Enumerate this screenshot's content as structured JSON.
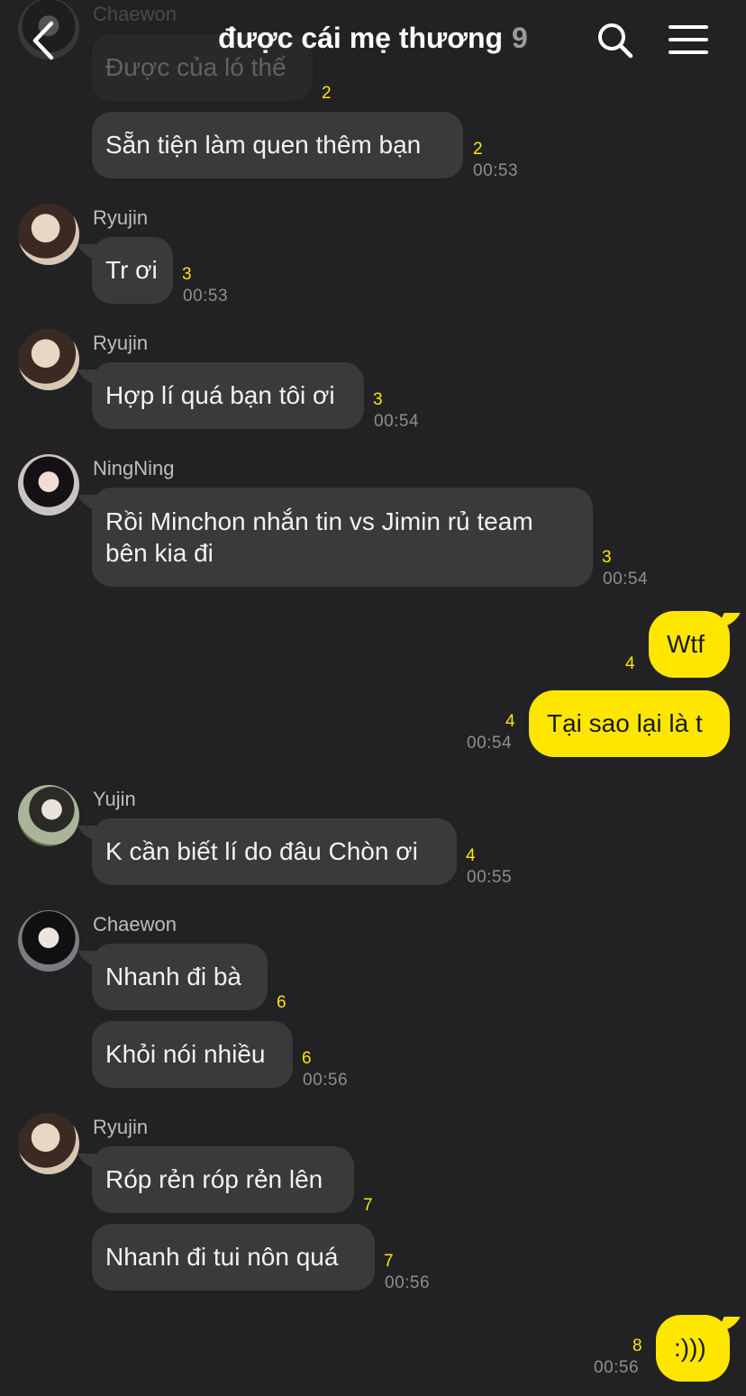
{
  "header": {
    "title": "được cái mẹ thương",
    "member_count": "9",
    "icons": [
      "back-icon",
      "search-icon",
      "menu-icon"
    ]
  },
  "colors": {
    "background": "#222224",
    "bubble": "#3a3a3c",
    "mine": "#ffe600",
    "unread": "#ffe600"
  },
  "messages": {
    "m0": {
      "sender": "Chaewon",
      "text": "Được của ló thế",
      "unread": "2"
    },
    "m1": {
      "text": "Sẵn tiện làm quen thêm bạn",
      "unread": "2",
      "time": "00:53"
    },
    "m2": {
      "sender": "Ryujin",
      "text": "Tr ơi",
      "unread": "3",
      "time": "00:53"
    },
    "m3": {
      "sender": "Ryujin",
      "text": "Hợp lí quá bạn tôi ơi",
      "unread": "3",
      "time": "00:54"
    },
    "m4": {
      "sender": "NingNing",
      "text": "Rồi Minchon nhắn tin vs Jimin rủ team bên kia đi",
      "unread": "3",
      "time": "00:54"
    },
    "m5": {
      "text": "Wtf",
      "unread": "4"
    },
    "m6": {
      "text": "Tại sao lại là t",
      "unread": "4",
      "time": "00:54"
    },
    "m7": {
      "sender": "Yujin",
      "text": "K cần biết lí do đâu Chòn ơi",
      "unread": "4",
      "time": "00:55"
    },
    "m8": {
      "sender": "Chaewon",
      "text": "Nhanh đi bà",
      "unread": "6"
    },
    "m9": {
      "text": "Khỏi nói nhiều",
      "unread": "6",
      "time": "00:56"
    },
    "m10": {
      "sender": "Ryujin",
      "text": "Róp rẻn róp rẻn lên",
      "unread": "7"
    },
    "m11": {
      "text": "Nhanh đi tui nôn quá",
      "unread": "7",
      "time": "00:56"
    },
    "m12": {
      "text": ":)))",
      "unread": "8",
      "time": "00:56"
    }
  }
}
